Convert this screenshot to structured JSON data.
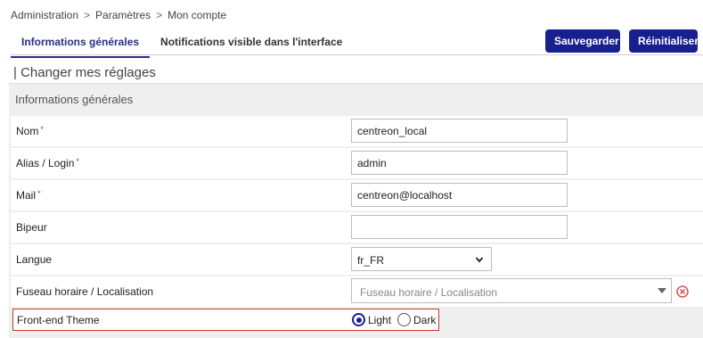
{
  "breadcrumb": {
    "items": [
      "Administration",
      "Paramètres",
      "Mon compte"
    ],
    "separator": ">"
  },
  "tabs": [
    {
      "label": "Informations générales",
      "active": true
    },
    {
      "label": "Notifications visible dans l'interface",
      "active": false
    }
  ],
  "toolbar": {
    "save_label": "Sauvegarder",
    "reset_label": "Réinitialiser"
  },
  "section": {
    "title": "| Changer mes réglages",
    "form_header": "Informations générales"
  },
  "form": {
    "required_marker": "*",
    "nom": {
      "label": "Nom",
      "value": "centreon_local",
      "required": true
    },
    "alias": {
      "label": "Alias / Login",
      "value": "admin",
      "required": true
    },
    "mail": {
      "label": "Mail",
      "value": "centreon@localhost",
      "required": true
    },
    "bipeur": {
      "label": "Bipeur",
      "value": "",
      "required": false
    },
    "langue": {
      "label": "Langue",
      "value": "fr_FR"
    },
    "fuseau": {
      "label": "Fuseau horaire / Localisation",
      "placeholder": "Fuseau horaire / Localisation"
    },
    "theme": {
      "label": "Front-end Theme",
      "options": [
        "Light",
        "Dark"
      ],
      "selected": "Light"
    }
  },
  "colors": {
    "primary": "#18208f",
    "active_tab": "#2b2e83",
    "required": "#c0392b",
    "highlight_border": "#c0392b",
    "clear_icon": "#d9534f"
  },
  "icons": {
    "langue_dropdown": "chevron-down-icon",
    "fuseau_dropdown": "caret-down-icon",
    "fuseau_clear": "clear-circle-icon"
  }
}
